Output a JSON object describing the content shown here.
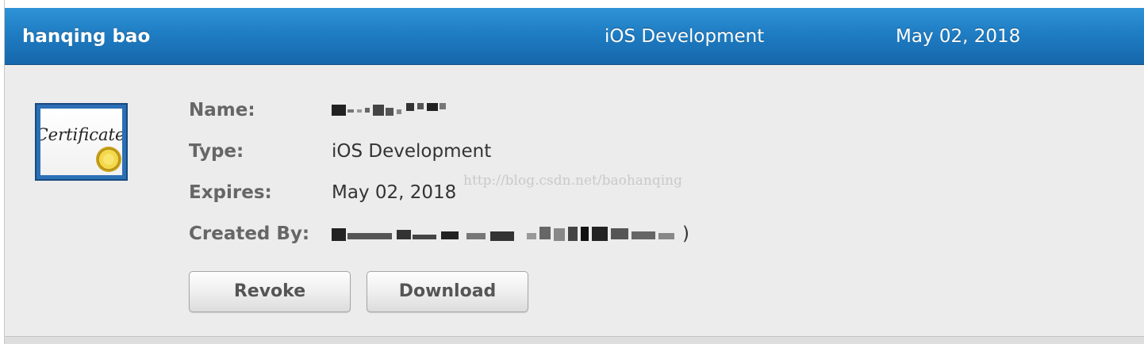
{
  "header": {
    "name": "hanqing bao",
    "type": "iOS Development",
    "date": "May 02, 2018"
  },
  "certificate_icon": {
    "text": "Certificate",
    "icon": "certificate-icon"
  },
  "details": {
    "name_label": "Name:",
    "name_value": "",
    "type_label": "Type:",
    "type_value": "iOS Development",
    "expires_label": "Expires:",
    "expires_value": "May 02, 2018",
    "created_by_label": "Created By:",
    "created_by_value": "",
    "created_by_suffix": ")"
  },
  "buttons": {
    "revoke": "Revoke",
    "download": "Download"
  },
  "watermark": "http://blog.csdn.net/baohanqing",
  "colors": {
    "header_top": "#2f93d6",
    "header_bottom": "#1667ab",
    "panel_bg": "#ececec",
    "label": "#666666",
    "value": "#333333"
  }
}
